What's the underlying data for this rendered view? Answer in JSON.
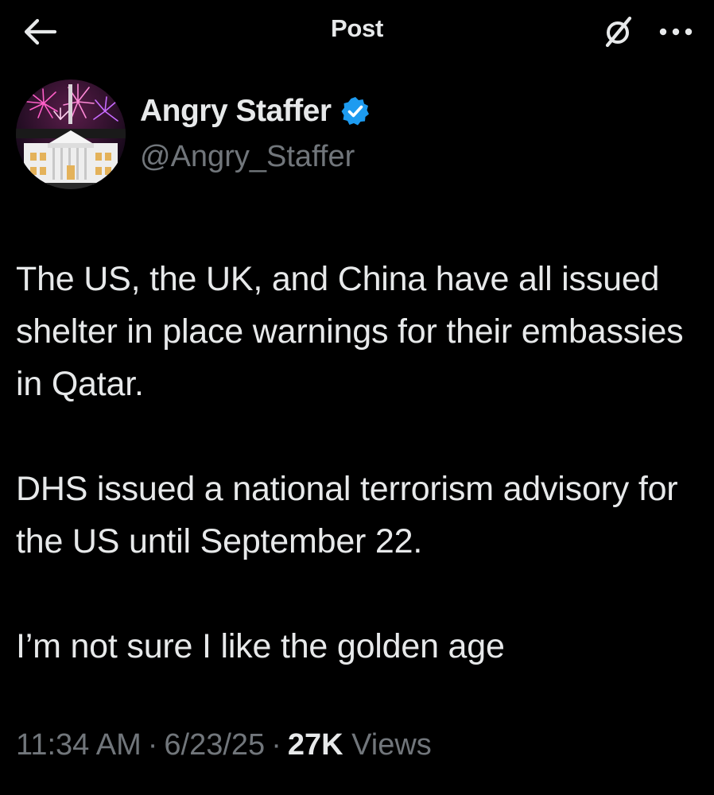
{
  "header": {
    "title": "Post",
    "back_icon": "arrow-left-icon",
    "grok_icon": "grok-icon",
    "more_icon": "more-horizontal-icon"
  },
  "author": {
    "name": "Angry Staffer",
    "handle": "@Angry_Staffer",
    "verified": true,
    "verified_color": "#1d9bf0",
    "avatar_icon": "white-house-fireworks-avatar"
  },
  "post": {
    "paragraphs": [
      "The US, the UK, and China have all issued shelter in place warnings for their embassies in Qatar.",
      "DHS issued a national terrorism advisory for the US until September 22.",
      "I’m not sure I like the golden age"
    ]
  },
  "meta": {
    "time": "11:34 AM",
    "separator": "·",
    "date": "6/23/25",
    "views_count": "27K",
    "views_label": "Views"
  },
  "colors": {
    "background": "#000000",
    "primary_text": "#e7e9ea",
    "secondary_text": "#71767b",
    "accent": "#1d9bf0"
  }
}
